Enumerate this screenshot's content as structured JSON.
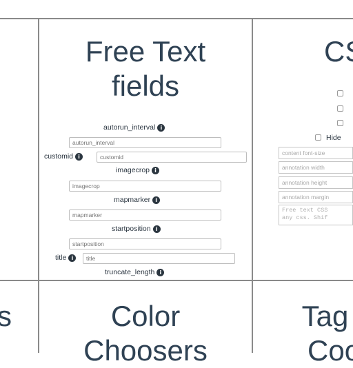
{
  "top_center": {
    "title_line1": "Free Text",
    "title_line2": "fields",
    "fields": [
      {
        "label": "autorun_interval",
        "placeholder": "autorun_interval"
      },
      {
        "label": "customid",
        "placeholder": "customid"
      },
      {
        "label": "imagecrop",
        "placeholder": "imagecrop"
      },
      {
        "label": "mapmarker",
        "placeholder": "mapmarker"
      },
      {
        "label": "startposition",
        "placeholder": "startposition"
      },
      {
        "label": "title",
        "placeholder": "title"
      },
      {
        "label": "truncate_length"
      }
    ]
  },
  "top_right": {
    "title_partial": "CS",
    "hide_label": "Hide",
    "inputs": [
      "content font-size",
      "annotation width",
      "annotation height",
      "annotation margin"
    ],
    "textarea_text": "Free text CSS\nany css. Shif"
  },
  "bottom_left": {
    "title_partial": "s"
  },
  "bottom_center": {
    "title_line1": "Color",
    "title_line2": "Choosers"
  },
  "bottom_right": {
    "title_line1": "Tag",
    "title_line2": "Coo"
  },
  "info_glyph": "i"
}
